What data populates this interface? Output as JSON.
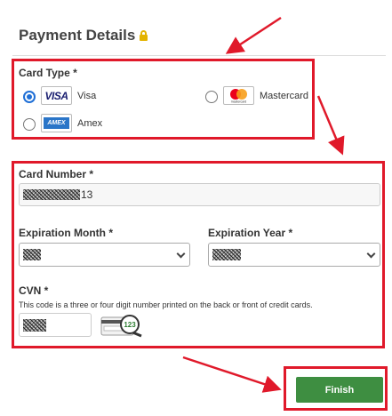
{
  "header": {
    "title": "Payment Details",
    "lock_icon": "lock-icon"
  },
  "card_type": {
    "label": "Card Type *",
    "options": [
      {
        "logo_text": "VISA",
        "label": "Visa",
        "checked": true
      },
      {
        "logo_text": "mastercard",
        "label": "Mastercard",
        "checked": false
      },
      {
        "logo_text": "AMEX",
        "label": "Amex",
        "checked": false
      }
    ]
  },
  "card_number": {
    "label": "Card Number *",
    "visible_suffix": "13"
  },
  "expiration_month": {
    "label": "Expiration Month *"
  },
  "expiration_year": {
    "label": "Expiration Year *"
  },
  "cvn": {
    "label": "CVN *",
    "help": "This code is a three or four digit number printed on the back or front of credit cards.",
    "illustration_digits": "123"
  },
  "finish": {
    "label": "Finish"
  },
  "colors": {
    "annotation": "#e0192a",
    "finish_button": "#3e8e41",
    "radio_selected": "#1f6fd6",
    "lock": "#e3b300"
  }
}
